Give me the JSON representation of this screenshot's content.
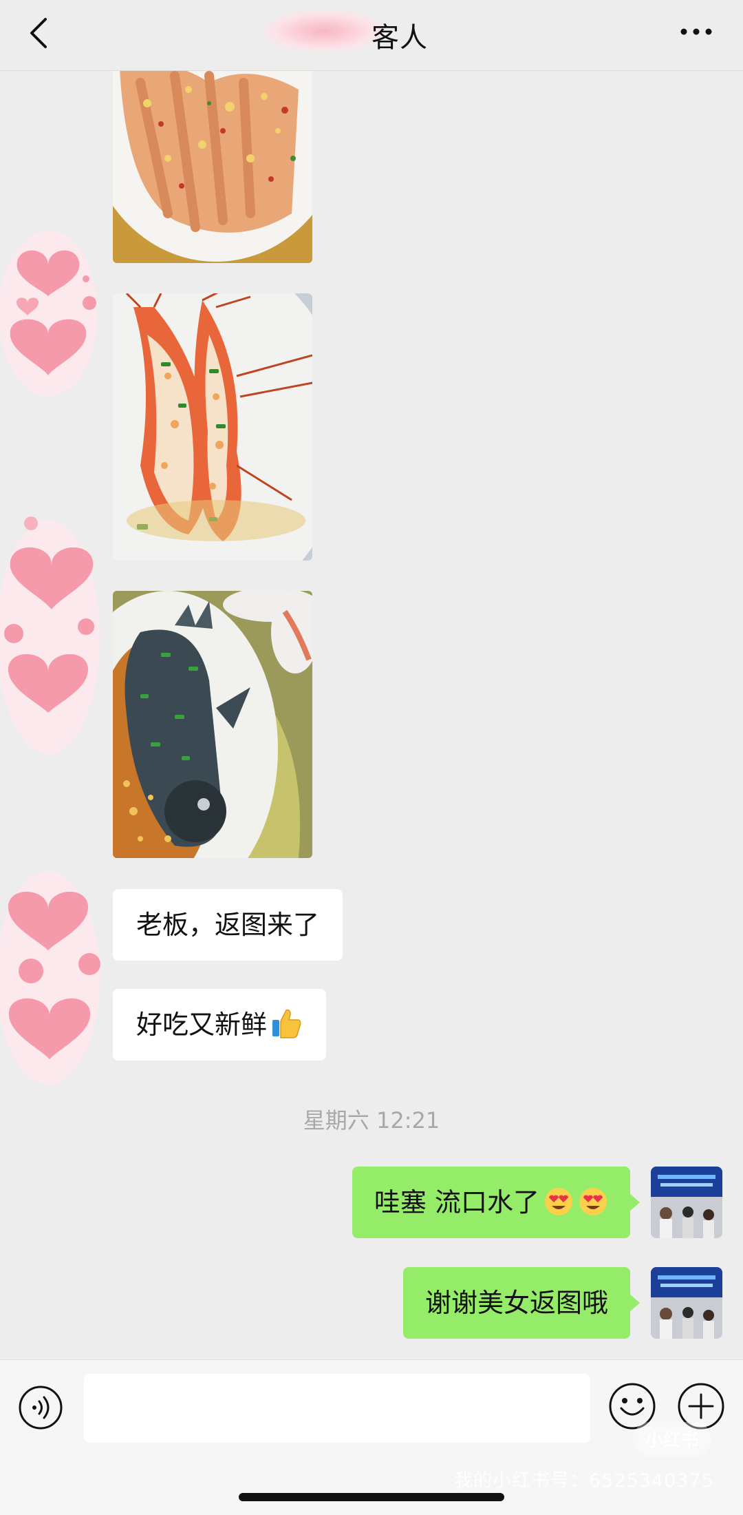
{
  "header": {
    "title": "客人"
  },
  "messages_in": [
    {
      "text": "老板，返图来了"
    },
    {
      "text": "好吃又新鲜"
    }
  ],
  "timestamp": "星期六 12:21",
  "messages_out": [
    {
      "text": "哇塞 流口水了"
    },
    {
      "text": "谢谢美女返图哦"
    }
  ],
  "icons": {
    "back": "chevron-left-icon",
    "more": "ellipsis-icon",
    "voice": "voice-icon",
    "emoji": "smiley-icon",
    "plus": "plus-icon"
  },
  "watermark": {
    "logo": "小红书",
    "text": "我的小红书号：6525340375"
  },
  "colors": {
    "background": "#ededed",
    "bubble_out": "#95ec69",
    "bubble_in": "#ffffff"
  }
}
